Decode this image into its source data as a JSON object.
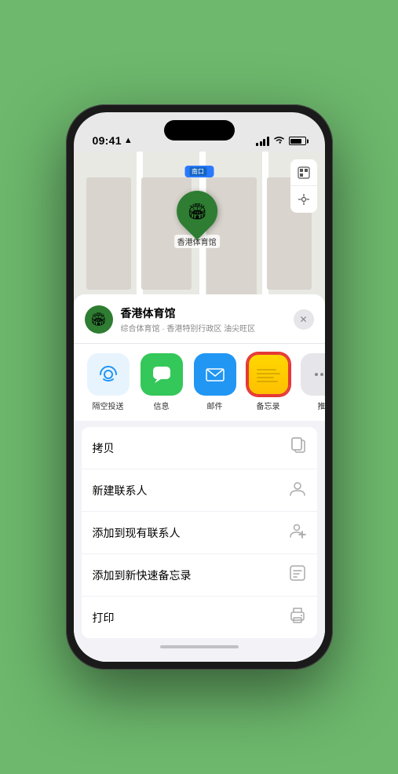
{
  "status_bar": {
    "time": "09:41",
    "location_arrow": "▶"
  },
  "map": {
    "label": "南口",
    "pin_label": "香港体育馆"
  },
  "venue": {
    "name": "香港体育馆",
    "subtitle": "综合体育馆 · 香港特别行政区 油尖旺区",
    "icon": "🏟"
  },
  "share_items": [
    {
      "id": "airdrop",
      "label": "隔空投送",
      "icon": "📡"
    },
    {
      "id": "messages",
      "label": "信息",
      "icon": "💬"
    },
    {
      "id": "mail",
      "label": "邮件",
      "icon": "✉"
    },
    {
      "id": "notes",
      "label": "备忘录",
      "icon": ""
    },
    {
      "id": "more",
      "label": "推",
      "icon": "⋯"
    }
  ],
  "actions": [
    {
      "label": "拷贝",
      "icon": "⎘"
    },
    {
      "label": "新建联系人",
      "icon": "👤"
    },
    {
      "label": "添加到现有联系人",
      "icon": "👤+"
    },
    {
      "label": "添加到新快速备忘录",
      "icon": "⊞"
    },
    {
      "label": "打印",
      "icon": "🖨"
    }
  ],
  "close_label": "✕"
}
